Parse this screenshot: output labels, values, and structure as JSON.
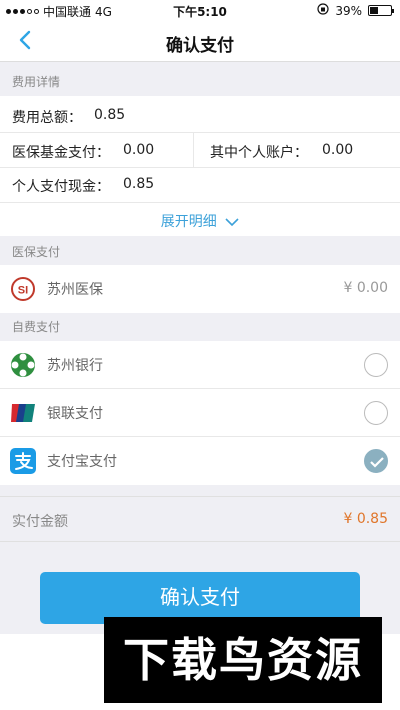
{
  "status_bar": {
    "carrier": "中国联通",
    "network": "4G",
    "time": "下午5:10",
    "battery": "39%",
    "battery_level": 0.39
  },
  "nav": {
    "title": "确认支付",
    "back_icon": "chevron-left-icon"
  },
  "fee_details": {
    "header": "费用详情",
    "total_label": "费用总额：",
    "total_value": "0.85",
    "fund_label": "医保基金支付：",
    "fund_value": "0.00",
    "personal_account_label": "其中个人账户：",
    "personal_account_value": "0.00",
    "cash_label": "个人支付现金：",
    "cash_value": "0.85",
    "expand_label": "展开明细"
  },
  "medical_insurance": {
    "header": "医保支付",
    "name": "苏州医保",
    "amount": "¥ 0.00"
  },
  "self_pay": {
    "header": "自费支付",
    "options": [
      {
        "name": "苏州银行",
        "icon": "suzhou-bank-icon",
        "checked": false
      },
      {
        "name": "银联支付",
        "icon": "unionpay-icon",
        "checked": false
      },
      {
        "name": "支付宝支付",
        "icon": "alipay-icon",
        "checked": true
      }
    ]
  },
  "total": {
    "label": "实付金额",
    "value": "¥ 0.85"
  },
  "confirm_button": "确认支付",
  "watermark": "下载鸟资源",
  "colors": {
    "accent": "#2ea5e5",
    "link": "#3ca1d9",
    "amount": "#e0762b"
  }
}
